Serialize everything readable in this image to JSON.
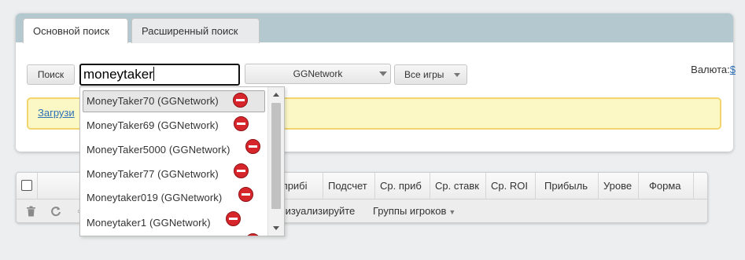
{
  "tabs": [
    {
      "label": "Основной поиск",
      "active": true
    },
    {
      "label": "Расширенный поиск",
      "active": false
    }
  ],
  "search": {
    "button_label": "Поиск",
    "input_value": "moneytaker",
    "network_select": "GGNetwork",
    "games_select": "Все игры"
  },
  "currency": {
    "label": "Валюта:",
    "symbol": "$"
  },
  "notice": {
    "link_text": "Загрузи"
  },
  "autocomplete": {
    "items": [
      {
        "label": "MoneyTaker70 (GGNetwork)",
        "icon": "no-entry-icon"
      },
      {
        "label": "MoneyTaker69 (GGNetwork)",
        "icon": "no-entry-icon"
      },
      {
        "label": "MoneyTaker5000 (GGNetwork)",
        "icon": "no-entry-icon"
      },
      {
        "label": "MoneyTaker77 (GGNetwork)",
        "icon": "no-entry-icon"
      },
      {
        "label": "Moneytaker019 (GGNetwork)",
        "icon": "no-entry-icon"
      },
      {
        "label": "Moneytaker1 (GGNetwork)",
        "icon": "no-entry-icon"
      }
    ]
  },
  "grid": {
    "columns": [
      "я прибі",
      "Подсчет",
      "Ср. приб",
      "Ср. ставк",
      "Ср. ROI",
      "Прибыль",
      "Урове",
      "Форма"
    ],
    "toolbar": {
      "visualize_label": "Визуализируйте",
      "groups_label": "Группы игроков"
    }
  },
  "colors": {
    "tabbar": "#b4c8d0",
    "notice_bg": "#fcf8c6",
    "notice_border": "#f2d56e",
    "link": "#2b6fb6",
    "stop_icon": "#d6252b"
  }
}
